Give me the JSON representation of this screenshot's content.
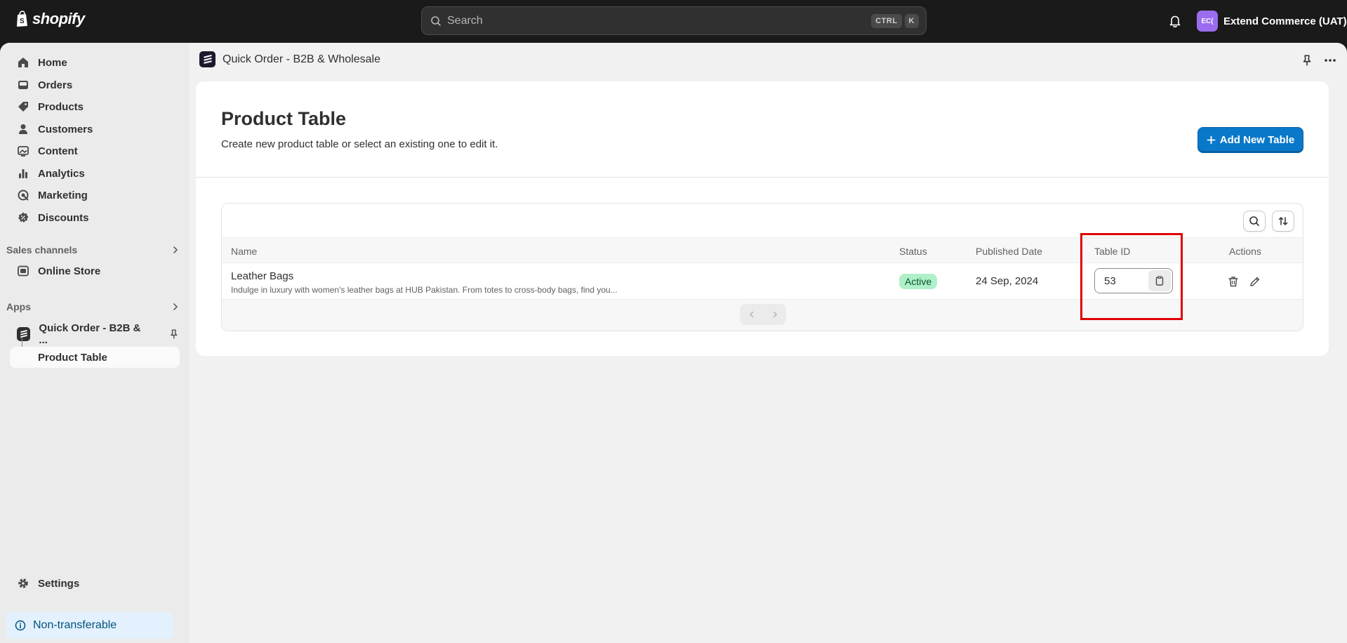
{
  "topbar": {
    "logo_text": "shopify",
    "search_placeholder": "Search",
    "shortcut_keys": [
      "CTRL",
      "K"
    ],
    "store_initials": "EC(",
    "store_name": "Extend Commerce (UAT)"
  },
  "sidebar": {
    "items": [
      {
        "label": "Home",
        "icon": "home-icon"
      },
      {
        "label": "Orders",
        "icon": "inbox-icon"
      },
      {
        "label": "Products",
        "icon": "tag-icon"
      },
      {
        "label": "Customers",
        "icon": "person-icon"
      },
      {
        "label": "Content",
        "icon": "image-icon"
      },
      {
        "label": "Analytics",
        "icon": "bar-chart-icon"
      },
      {
        "label": "Marketing",
        "icon": "target-icon"
      },
      {
        "label": "Discounts",
        "icon": "discount-icon"
      }
    ],
    "sales_channels_label": "Sales channels",
    "online_store_label": "Online Store",
    "apps_label": "Apps",
    "app_name": "Quick Order - B2B & ...",
    "app_sub_item": "Product Table",
    "settings_label": "Settings",
    "non_transferable_label": "Non-transferable"
  },
  "app_header": {
    "title": "Quick Order - B2B & Wholesale"
  },
  "page": {
    "title": "Product Table",
    "subtitle": "Create new product table or select an existing one to edit it.",
    "add_button_label": "Add New Table"
  },
  "table": {
    "columns": [
      "Name",
      "Status",
      "Published Date",
      "Table ID",
      "Actions"
    ],
    "rows": [
      {
        "name": "Leather Bags",
        "description": "Indulge in luxury with women's leather bags at HUB Pakistan. From totes to cross-body bags, find you...",
        "status": "Active",
        "published_date": "24 Sep, 2024",
        "table_id": "53"
      }
    ]
  },
  "colors": {
    "accent": "#0a78c9",
    "status_active_bg": "#aff0c8",
    "highlight": "#e00000",
    "topbar": "#1a1a1a"
  }
}
